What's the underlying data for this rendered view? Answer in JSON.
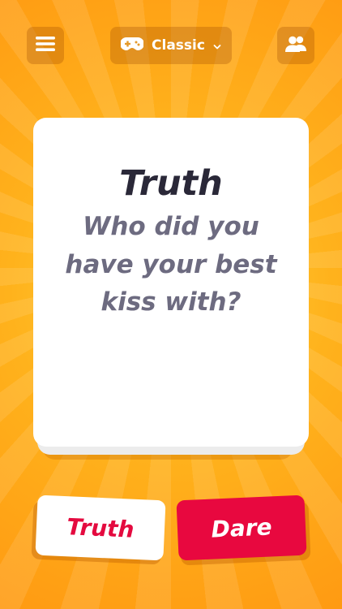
{
  "header": {
    "menu_icon": "hamburger-menu-icon",
    "mode_icon": "gamepad-icon",
    "mode_label": "Classic",
    "mode_chevron_icon": "chevron-down-icon",
    "players_icon": "users-icon"
  },
  "card": {
    "title": "Truth",
    "question": "Who did you have your best kiss with?"
  },
  "actions": {
    "truth_label": "Truth",
    "dare_label": "Dare"
  },
  "colors": {
    "background": "#ffa816",
    "truth_text": "#e40a3f",
    "dare_background": "#e8083f",
    "card_title": "#2a2838",
    "card_question": "#6d6b80"
  }
}
